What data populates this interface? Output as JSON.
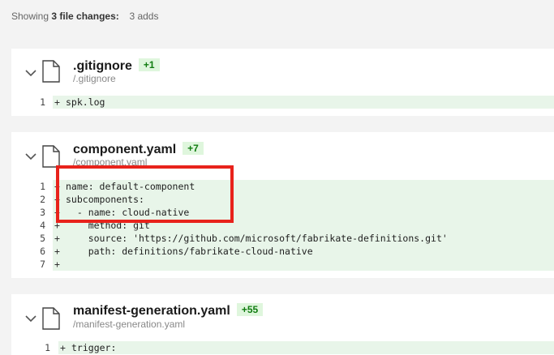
{
  "summary": {
    "prefix": "Showing",
    "count": "3 file changes:",
    "adds": "3 adds"
  },
  "files": [
    {
      "name": ".gitignore",
      "badge": "+1",
      "path": "/.gitignore",
      "lines": [
        {
          "num": "1",
          "sign": "+",
          "text": "spk.log"
        }
      ]
    },
    {
      "name": "component.yaml",
      "badge": "+7",
      "path": "/component.yaml",
      "lines": [
        {
          "num": "1",
          "sign": "+",
          "text": "name: default-component"
        },
        {
          "num": "2",
          "sign": "+",
          "text": "subcomponents:"
        },
        {
          "num": "3",
          "sign": "+",
          "text": "  - name: cloud-native"
        },
        {
          "num": "4",
          "sign": "+",
          "text": "    method: git"
        },
        {
          "num": "5",
          "sign": "+",
          "text": "    source: 'https://github.com/microsoft/fabrikate-definitions.git'"
        },
        {
          "num": "6",
          "sign": "+",
          "text": "    path: definitions/fabrikate-cloud-native"
        },
        {
          "num": "7",
          "sign": "+",
          "text": ""
        }
      ]
    },
    {
      "name": "manifest-generation.yaml",
      "badge": "+55",
      "path": "/manifest-generation.yaml",
      "lines": [
        {
          "num": "1",
          "sign": "+",
          "text": "trigger:"
        }
      ]
    }
  ],
  "colors": {
    "added_background": "#e8f5e9",
    "badge_text": "#107c10",
    "badge_background": "#dff6dd",
    "annotation_box": "#e8221b"
  }
}
